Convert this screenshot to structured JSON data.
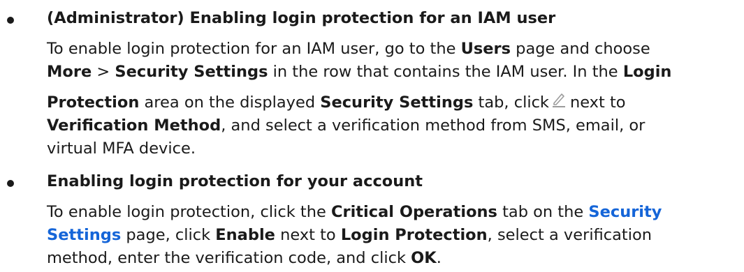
{
  "items": [
    {
      "heading": "(Administrator) Enabling login protection for an IAM user",
      "p1": {
        "t1": "To enable login protection for an IAM user, go to the ",
        "b1": "Users",
        "t2": " page and choose",
        "b2": "More",
        "t3": " > ",
        "b3": "Security Settings",
        "t4": " in the row that contains the IAM user. In the ",
        "b4": "Login",
        "b5": "Protection",
        "t5": " area on the displayed ",
        "b6": "Security Settings",
        "t6": " tab, click",
        "t7": "next to",
        "b7": "Verification Method",
        "t8": ", and select a verification method from SMS, email, or",
        "t9": "virtual MFA device."
      }
    },
    {
      "heading": "Enabling login protection for your account",
      "p1": {
        "t1": "To enable login protection, click the ",
        "b1": "Critical Operations",
        "t2": " tab on the ",
        "link1": "Security",
        "link2": "Settings",
        "t3": " page, click ",
        "b2": "Enable",
        "t4": " next to ",
        "b3": "Login Protection",
        "t5": ", select a verification",
        "t6": "method, enter the verification code, and click ",
        "b4": "OK",
        "t7": "."
      }
    }
  ],
  "icons": {
    "edit": "pencil-edit-icon",
    "edit_color": "#9b9b9b"
  },
  "colors": {
    "text": "#1a1a1a",
    "link": "#1565d8"
  }
}
